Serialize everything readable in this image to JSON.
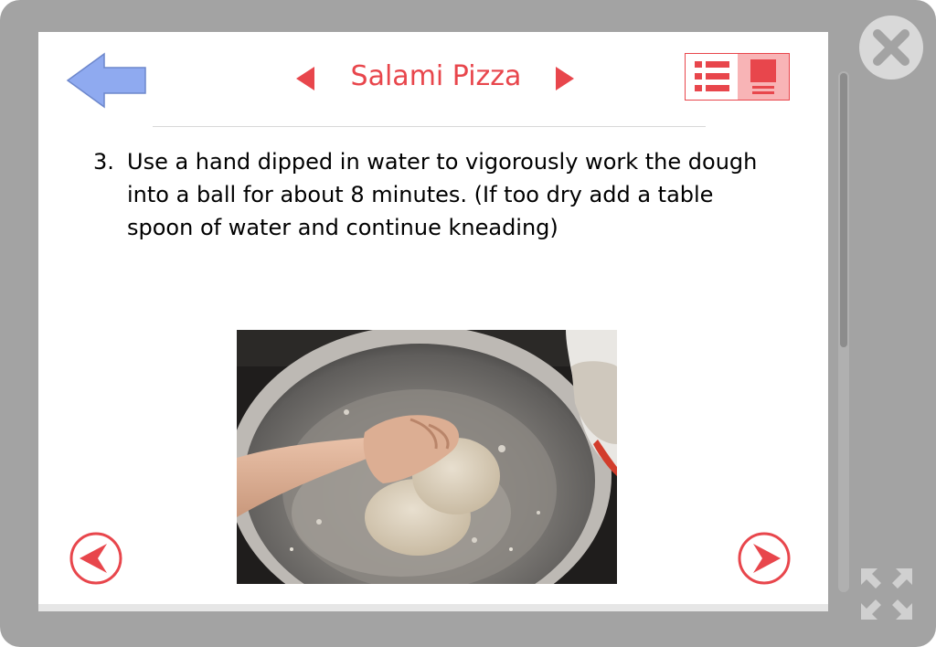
{
  "header": {
    "title": "Salami Pizza"
  },
  "step": {
    "number": "3.",
    "text": "Use a hand dipped in water to vigorously work the dough into a ball for about 8 minutes.  (If too dry add a table spoon of water and continue kneading)"
  },
  "icons": {
    "back": "arrow-left-icon",
    "prev_recipe": "triangle-left-icon",
    "next_recipe": "triangle-right-icon",
    "list_view": "list-icon",
    "page_view": "page-icon",
    "prev_step": "circle-chevron-left-icon",
    "next_step": "circle-chevron-right-icon",
    "close": "close-icon",
    "expand": "expand-icon"
  },
  "colors": {
    "accent": "#e8464c",
    "back_arrow": "#8faaf0",
    "frame": "#a3a3a3",
    "toggle_active": "#f8b4b6"
  },
  "view_toggle": {
    "selected": "page"
  }
}
